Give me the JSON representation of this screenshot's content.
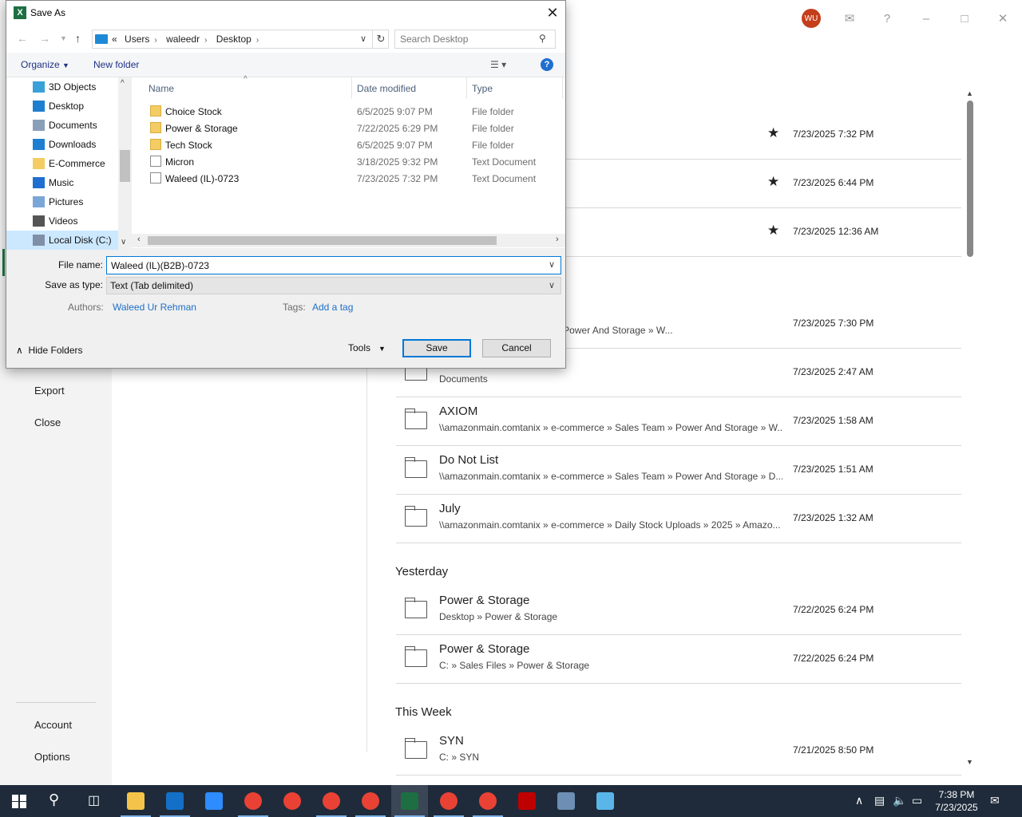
{
  "backstage": {
    "nav_bottom": [
      "Export",
      "Close",
      "Account",
      "Options"
    ],
    "avatar_initials": "WU",
    "sections": {
      "yesterday": "Yesterday",
      "this_week": "This Week"
    },
    "rows": [
      {
        "name": "",
        "path": "",
        "date": "7/23/2025 7:32 PM",
        "pinned": true
      },
      {
        "name": "",
        "path": "",
        "date": "7/23/2025 6:44 PM",
        "pinned": true
      },
      {
        "name": "",
        "path": "",
        "date": "7/23/2025 12:36 AM",
        "pinned": true
      },
      {
        "name": "",
        "path": "...commerce » Sales Team » Power And Storage » W...",
        "date": "7/23/2025 7:30 PM",
        "pinned": false
      },
      {
        "name": "Documents",
        "path": "Documents",
        "date": "7/23/2025 2:47 AM",
        "pinned": false
      },
      {
        "name": "AXIOM",
        "path": "\\\\amazonmain.comtanix » e-commerce » Sales Team » Power And Storage » W...",
        "date": "7/23/2025 1:58 AM",
        "pinned": false
      },
      {
        "name": "Do Not List",
        "path": "\\\\amazonmain.comtanix » e-commerce » Sales Team » Power And Storage » D...",
        "date": "7/23/2025 1:51 AM",
        "pinned": false
      },
      {
        "name": "July",
        "path": "\\\\amazonmain.comtanix » e-commerce » Daily Stock Uploads » 2025 » Amazo...",
        "date": "7/23/2025 1:32 AM",
        "pinned": false
      },
      {
        "name": "Power & Storage",
        "path": "Desktop » Power & Storage",
        "date": "7/22/2025 6:24 PM",
        "pinned": false
      },
      {
        "name": "Power & Storage",
        "path": "C: » Sales Files » Power & Storage",
        "date": "7/22/2025 6:24 PM",
        "pinned": false
      },
      {
        "name": "SYN",
        "path": "C: » SYN",
        "date": "7/21/2025 8:50 PM",
        "pinned": false
      }
    ]
  },
  "dialog": {
    "title": "Save As",
    "app_icon": "X",
    "breadcrumb": [
      "Users",
      "waleedr",
      "Desktop"
    ],
    "breadcrumb_prefix": "«",
    "search_placeholder": "Search Desktop",
    "commands": {
      "organize": "Organize",
      "new_folder": "New folder",
      "help": "?"
    },
    "nav_items": [
      {
        "label": "3D Objects",
        "icon": "cube-icon",
        "color": "#3aa0d8"
      },
      {
        "label": "Desktop",
        "icon": "desktop-icon",
        "color": "#1e7fd0"
      },
      {
        "label": "Documents",
        "icon": "document-icon",
        "color": "#8aa0b8"
      },
      {
        "label": "Downloads",
        "icon": "download-icon",
        "color": "#1e7fd0"
      },
      {
        "label": "E-Commerce",
        "icon": "folder-icon",
        "color": "#f3cd63"
      },
      {
        "label": "Music",
        "icon": "music-icon",
        "color": "#1e6fd0"
      },
      {
        "label": "Pictures",
        "icon": "pictures-icon",
        "color": "#7aa7d8"
      },
      {
        "label": "Videos",
        "icon": "video-icon",
        "color": "#555555"
      },
      {
        "label": "Local Disk (C:)",
        "icon": "disk-icon",
        "color": "#7f8fa6"
      }
    ],
    "columns": {
      "name": "Name",
      "date": "Date modified",
      "type": "Type"
    },
    "files": [
      {
        "name": "Choice Stock",
        "date": "6/5/2025 9:07 PM",
        "type": "File folder",
        "kind": "folder"
      },
      {
        "name": "Power & Storage",
        "date": "7/22/2025 6:29 PM",
        "type": "File folder",
        "kind": "folder"
      },
      {
        "name": "Tech Stock",
        "date": "6/5/2025 9:07 PM",
        "type": "File folder",
        "kind": "folder"
      },
      {
        "name": "Micron",
        "date": "3/18/2025 9:32 PM",
        "type": "Text Document",
        "kind": "doc"
      },
      {
        "name": "Waleed (IL)-0723",
        "date": "7/23/2025 7:32 PM",
        "type": "Text Document",
        "kind": "doc"
      }
    ],
    "file_name_label": "File name:",
    "file_name_value": "Waleed (IL)(B2B)-0723",
    "save_type_label": "Save as type:",
    "save_type_value": "Text (Tab delimited)",
    "authors_label": "Authors:",
    "authors_value": "Waleed Ur Rehman",
    "tags_label": "Tags:",
    "tags_value": "Add a tag",
    "hide_folders": "Hide Folders",
    "tools": "Tools",
    "save": "Save",
    "cancel": "Cancel"
  },
  "taskbar": {
    "apps": [
      {
        "name": "file-explorer",
        "color": "#f3c34a",
        "active": false,
        "underline": true
      },
      {
        "name": "outlook",
        "color": "#1470c7",
        "active": false,
        "underline": true
      },
      {
        "name": "zoom",
        "color": "#2d8cff",
        "active": false,
        "underline": false
      },
      {
        "name": "chrome",
        "color": "#e94235",
        "active": false,
        "underline": true
      },
      {
        "name": "chrome",
        "color": "#e94235",
        "active": false,
        "underline": false
      },
      {
        "name": "chrome",
        "color": "#e94235",
        "active": false,
        "underline": true
      },
      {
        "name": "chrome",
        "color": "#e94235",
        "active": false,
        "underline": true
      },
      {
        "name": "excel",
        "color": "#1d6f42",
        "active": true,
        "underline": true
      },
      {
        "name": "chrome",
        "color": "#e94235",
        "active": false,
        "underline": true
      },
      {
        "name": "chrome",
        "color": "#e94235",
        "active": false,
        "underline": true
      },
      {
        "name": "filezilla",
        "color": "#bf0000",
        "active": false,
        "underline": false
      },
      {
        "name": "calculator",
        "color": "#6c8fb3",
        "active": false,
        "underline": false
      },
      {
        "name": "remote-app",
        "color": "#5ab6e8",
        "active": false,
        "underline": false
      }
    ],
    "zoom_label": "zm",
    "time": "7:38 PM",
    "date": "7/23/2025"
  }
}
